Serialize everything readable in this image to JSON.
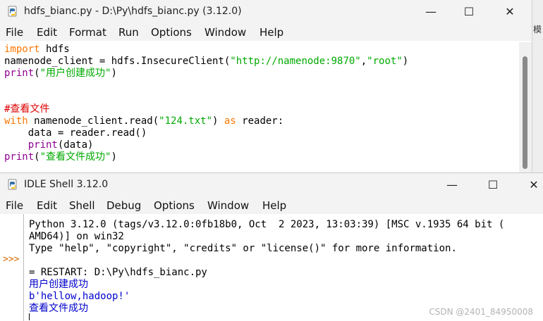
{
  "editor": {
    "title": "hdfs_bianc.py - D:\\Py\\hdfs_bianc.py (3.12.0)",
    "menu": [
      "File",
      "Edit",
      "Format",
      "Run",
      "Options",
      "Window",
      "Help"
    ],
    "code_lines": [
      [
        {
          "t": "import",
          "c": "kw"
        },
        {
          "t": " hdfs",
          "c": ""
        }
      ],
      [
        {
          "t": "namenode_client = hdfs.InsecureClient(",
          "c": ""
        },
        {
          "t": "\"http://namenode:9870\"",
          "c": "str"
        },
        {
          "t": ",",
          "c": ""
        },
        {
          "t": "\"root\"",
          "c": "str"
        },
        {
          "t": ")",
          "c": ""
        }
      ],
      [
        {
          "t": "print",
          "c": "bi"
        },
        {
          "t": "(",
          "c": ""
        },
        {
          "t": "\"用户创建成功\"",
          "c": "str"
        },
        {
          "t": ")",
          "c": ""
        }
      ],
      [],
      [],
      [
        {
          "t": "#查看文件",
          "c": "cmt"
        }
      ],
      [
        {
          "t": "with",
          "c": "kw"
        },
        {
          "t": " namenode_client.read(",
          "c": ""
        },
        {
          "t": "\"124.txt\"",
          "c": "str"
        },
        {
          "t": ") ",
          "c": ""
        },
        {
          "t": "as",
          "c": "kw"
        },
        {
          "t": " reader:",
          "c": ""
        }
      ],
      [
        {
          "t": "    data = reader.read()",
          "c": ""
        }
      ],
      [
        {
          "t": "    ",
          "c": ""
        },
        {
          "t": "print",
          "c": "bi"
        },
        {
          "t": "(data)",
          "c": ""
        }
      ],
      [
        {
          "t": "print",
          "c": "bi"
        },
        {
          "t": "(",
          "c": ""
        },
        {
          "t": "\"查看文件成功\"",
          "c": "str"
        },
        {
          "t": ")",
          "c": ""
        }
      ]
    ]
  },
  "side_strip_char": "模",
  "shell": {
    "title": "IDLE Shell 3.12.0",
    "menu": [
      "File",
      "Edit",
      "Shell",
      "Debug",
      "Options",
      "Window",
      "Help"
    ],
    "prompt": ">>>",
    "lines": [
      {
        "text": "Python 3.12.0 (tags/v3.12.0:0fb18b0, Oct  2 2023, 13:03:39) [MSC v.1935 64 bit (",
        "c": ""
      },
      {
        "text": "AMD64)] on win32",
        "c": ""
      },
      {
        "text": "Type \"help\", \"copyright\", \"credits\" or \"license()\" for more information.",
        "c": ""
      },
      {
        "text": "",
        "c": ""
      },
      {
        "text": "= RESTART: D:\\Py\\hdfs_bianc.py",
        "c": ""
      },
      {
        "text": "用户创建成功",
        "c": "out"
      },
      {
        "text": "b'hellow,hadoop!'",
        "c": "out"
      },
      {
        "text": "查看文件成功",
        "c": "out"
      }
    ]
  },
  "watermark": "CSDN @2401_84950008",
  "colors": {
    "keyword": "#ff7700",
    "builtin": "#900090",
    "string": "#00aa00",
    "comment": "#dd0000",
    "output": "#0000cc",
    "prompt": "#d46a00"
  }
}
